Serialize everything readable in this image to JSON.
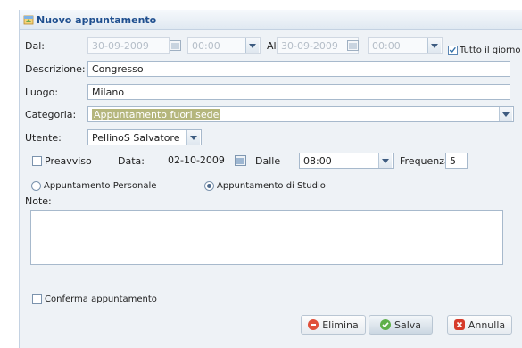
{
  "window": {
    "title": "Nuovo appuntamento"
  },
  "form": {
    "dal_label": "Dal:",
    "dal_date": "30-09-2009",
    "dal_time": "00:00",
    "al_label": "Al",
    "al_date": "30-09-2009",
    "al_time": "00:00",
    "tutto_giorno_label": "Tutto il giorno",
    "tutto_giorno_checked": true,
    "descrizione_label": "Descrizione:",
    "descrizione_value": "Congresso",
    "luogo_label": "Luogo:",
    "luogo_value": "Milano",
    "categoria_label": "Categoria:",
    "categoria_value": "Appuntamento fuori sede",
    "utente_label": "Utente:",
    "utente_value": "PellinoS Salvatore",
    "preavviso_label": "Preavviso",
    "preavviso_checked": false,
    "data_label": "Data:",
    "data_value": "02-10-2009",
    "dalle_label": "Dalle",
    "dalle_value": "08:00",
    "frequenza_label": "Frequenza:",
    "frequenza_value": "5",
    "radio_personale_label": "Appuntamento Personale",
    "radio_studio_label": "Appuntamento di Studio",
    "radio_selected": "studio",
    "note_label": "Note:",
    "note_value": "",
    "conferma_label": "Conferma appuntamento",
    "conferma_checked": false
  },
  "buttons": {
    "elimina_label": "Elimina",
    "salva_label": "Salva",
    "annulla_label": "Annulla"
  },
  "colors": {
    "title_text": "#1f4f8f",
    "category_highlight": "#b5b67d",
    "elimina_icon": "#e0503a",
    "salva_icon": "#5fb04a",
    "annulla_icon": "#d63b2a"
  }
}
